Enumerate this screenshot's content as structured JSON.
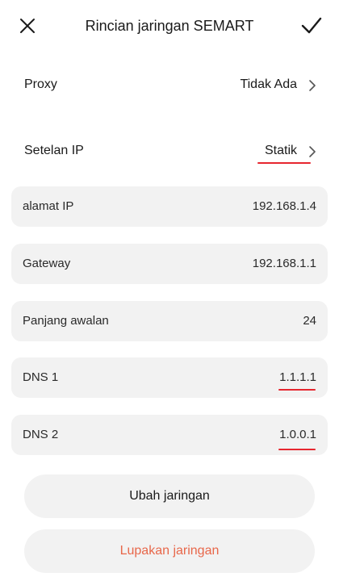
{
  "header": {
    "title": "Rincian jaringan SEMART",
    "close_icon": "close-icon",
    "confirm_icon": "check-icon"
  },
  "rows": {
    "proxy": {
      "label": "Proxy",
      "value": "Tidak Ada"
    },
    "ip_settings": {
      "label": "Setelan IP",
      "value": "Statik"
    }
  },
  "fields": {
    "ip_address": {
      "label": "alamat IP",
      "value": "192.168.1.4"
    },
    "gateway": {
      "label": "Gateway",
      "value": "192.168.1.1"
    },
    "prefix_length": {
      "label": "Panjang awalan",
      "value": "24"
    },
    "dns1": {
      "label": "DNS 1",
      "value": "1.1.1.1"
    },
    "dns2": {
      "label": "DNS 2",
      "value": "1.0.0.1"
    }
  },
  "buttons": {
    "change_network": "Ubah jaringan",
    "forget_network": "Lupakan jaringan"
  },
  "colors": {
    "annotation_red": "#e6262f",
    "danger_text": "#e8674a",
    "field_bg": "#f2f2f2"
  }
}
